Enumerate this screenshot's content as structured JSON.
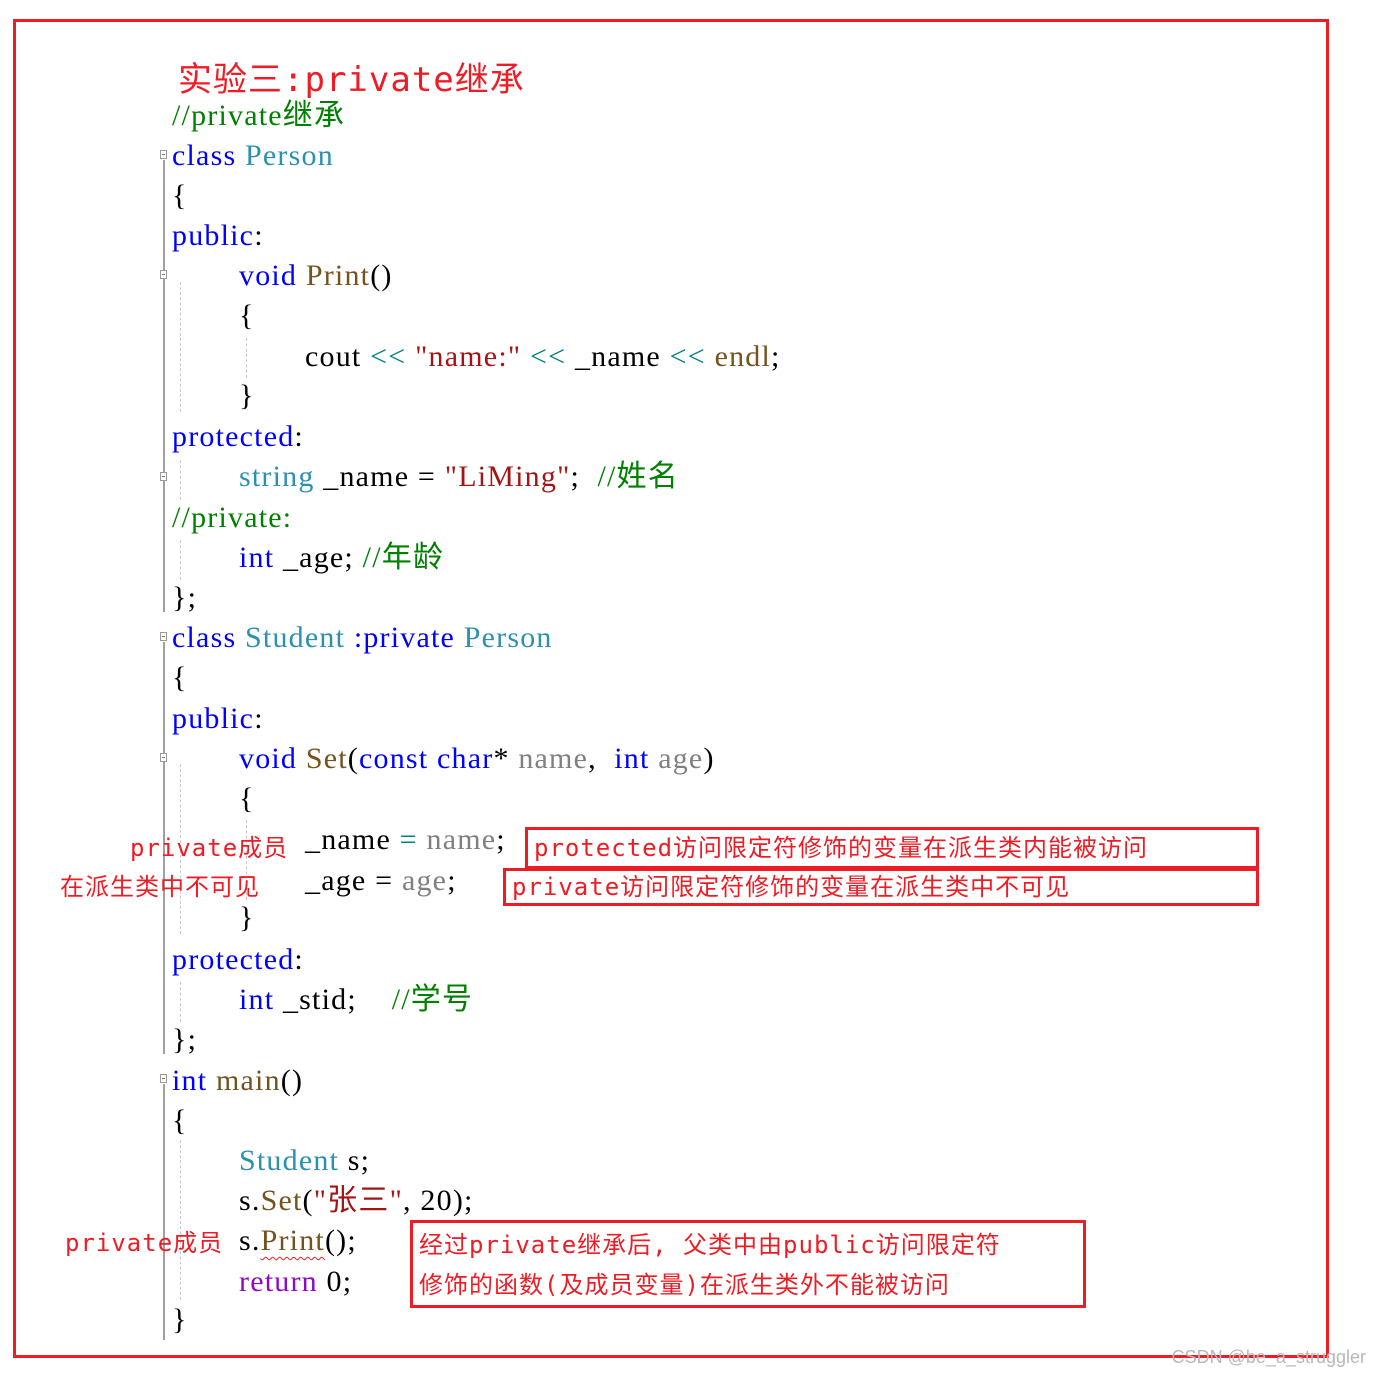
{
  "title": "实验三:private继承",
  "code": {
    "comment_top": "//private继承",
    "person_class": {
      "kw_class": "class",
      "name": "Person",
      "open": "{",
      "public": "public",
      "colon": ":",
      "print_ret": "void",
      "print_name": "Print",
      "print_parens": "()",
      "print_open": "{",
      "cout": "cout",
      "shl": "<<",
      "str_name": "\"name:\"",
      "var_name": "_name",
      "endl": "endl",
      "semi": ";",
      "print_close": "}",
      "protected": "protected",
      "string_type": "string",
      "eq": "=",
      "str_liming": "\"LiMing\"",
      "cmt_name": "//姓名",
      "cmt_private": "//private:",
      "int_type": "int",
      "var_age": "_age",
      "cmt_age": "//年龄",
      "close": "};"
    },
    "student_class": {
      "kw_class": "class",
      "name": "Student",
      "inherit": ":private",
      "base": "Person",
      "open": "{",
      "public": "public",
      "colon": ":",
      "set_ret": "void",
      "set_name": "Set",
      "lparen": "(",
      "kw_const": "const",
      "kw_char": "char",
      "star": "*",
      "param_name": "name",
      "comma": ",",
      "kw_int": "int",
      "param_age": "age",
      "rparen": ")",
      "set_open": "{",
      "assign_name_lhs": "_name",
      "assign_age_lhs": "_age",
      "eq": "=",
      "semi": ";",
      "set_close": "}",
      "protected": "protected",
      "var_stid": "_stid",
      "cmt_stid": "//学号",
      "close": "};"
    },
    "main_fn": {
      "ret": "int",
      "name": "main",
      "parens": "()",
      "open": "{",
      "student_type": "Student",
      "var_s": "s",
      "set_obj": "s.",
      "set_fn": "Set",
      "set_args_open": "(",
      "set_str": "\"张三\"",
      "set_rest": ", 20);",
      "print_obj": "s.",
      "print_fn": "Print",
      "print_rest": "();",
      "return_kw": "return",
      "return_val": "0;",
      "close": "}"
    }
  },
  "annotations": {
    "name_side": "private成员",
    "age_side": "在派生类中不可见",
    "protected_box": "protected访问限定符修饰的变量在派生类内能被访问",
    "private_box": "private访问限定符修饰的变量在派生类中不可见",
    "print_side": "private成员",
    "print_box_line1": "经过private继承后, 父类中由public访问限定符",
    "print_box_line2": "修饰的函数(及成员变量)在派生类外不能被访问"
  },
  "colors": {
    "annotation_red": "#ee1c25",
    "keyword": "#0000ff",
    "type": "#2b91af",
    "function": "#74531f",
    "string": "#a31515",
    "comment": "#008000",
    "control": "#8f08c4"
  },
  "watermark": "CSDN @be_a_struggler"
}
